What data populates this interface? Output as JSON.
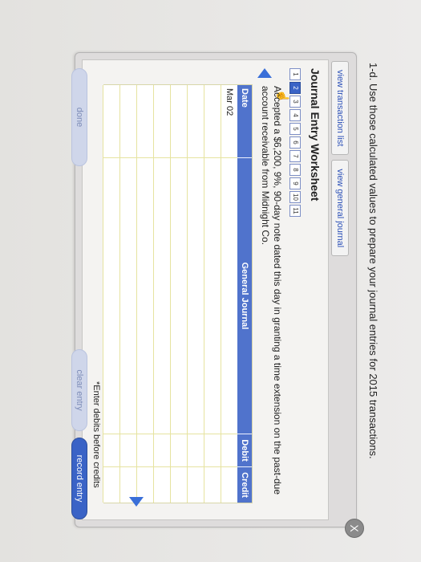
{
  "prompt": "1-d. Use those calculated values to prepare your journal entries for 2015 transactions.",
  "tabs": [
    "view transaction list",
    "view general journal"
  ],
  "worksheet": {
    "title": "Journal Entry Worksheet",
    "steps": [
      "1",
      "2",
      "3",
      "4",
      "5",
      "6",
      "7",
      "8",
      "9",
      "10",
      "11"
    ],
    "active_step": "2",
    "description": "Accepted a $6,200, 9%, 90-day note dated this day in granting a time extension on the past-due account receivable from Midnight Co."
  },
  "table": {
    "headers": {
      "date": "Date",
      "general_journal": "General Journal",
      "debit": "Debit",
      "credit": "Credit"
    },
    "rows": [
      {
        "date": "Mar 02",
        "account": "",
        "debit": "",
        "credit": ""
      },
      {
        "date": "",
        "account": "",
        "debit": "",
        "credit": ""
      },
      {
        "date": "",
        "account": "",
        "debit": "",
        "credit": ""
      },
      {
        "date": "",
        "account": "",
        "debit": "",
        "credit": ""
      },
      {
        "date": "",
        "account": "",
        "debit": "",
        "credit": ""
      },
      {
        "date": "",
        "account": "",
        "debit": "",
        "credit": ""
      },
      {
        "date": "",
        "account": "",
        "debit": "",
        "credit": ""
      },
      {
        "date": "",
        "account": "",
        "debit": "",
        "credit": ""
      }
    ]
  },
  "note": "*Enter debits before credits",
  "buttons": {
    "done": "done",
    "clear": "clear entry",
    "record": "record entry"
  },
  "close_label": "X",
  "hand_glyph": "☝"
}
